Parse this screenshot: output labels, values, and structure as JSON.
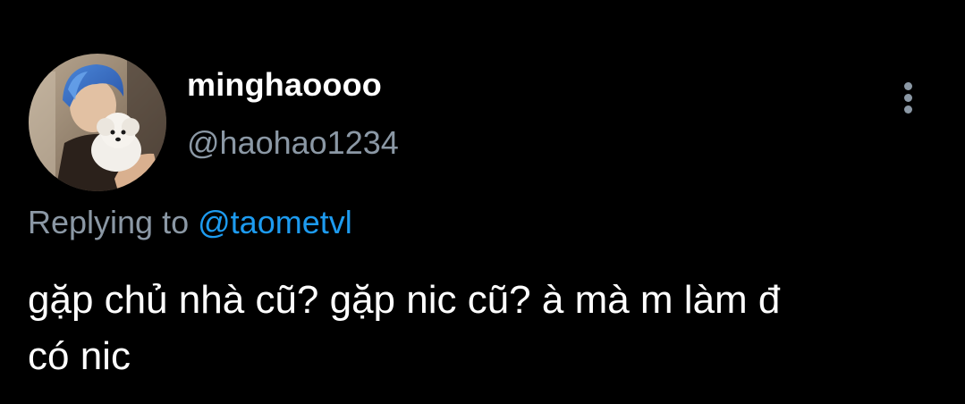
{
  "user": {
    "display_name": "minghaoooo",
    "handle": "@haohao1234"
  },
  "reply": {
    "prefix": "Replying to",
    "mention": "@taometvl"
  },
  "tweet": {
    "text_line1": "gặp chủ nhà cũ? gặp nic cũ? à mà m làm đ",
    "text_line2": "có nic"
  },
  "icons": {
    "more": "more-vertical-icon",
    "avatar": "avatar"
  },
  "colors": {
    "background": "#000000",
    "text_primary": "#ffffff",
    "text_secondary": "#8b98a5",
    "link": "#1d9bf0"
  }
}
